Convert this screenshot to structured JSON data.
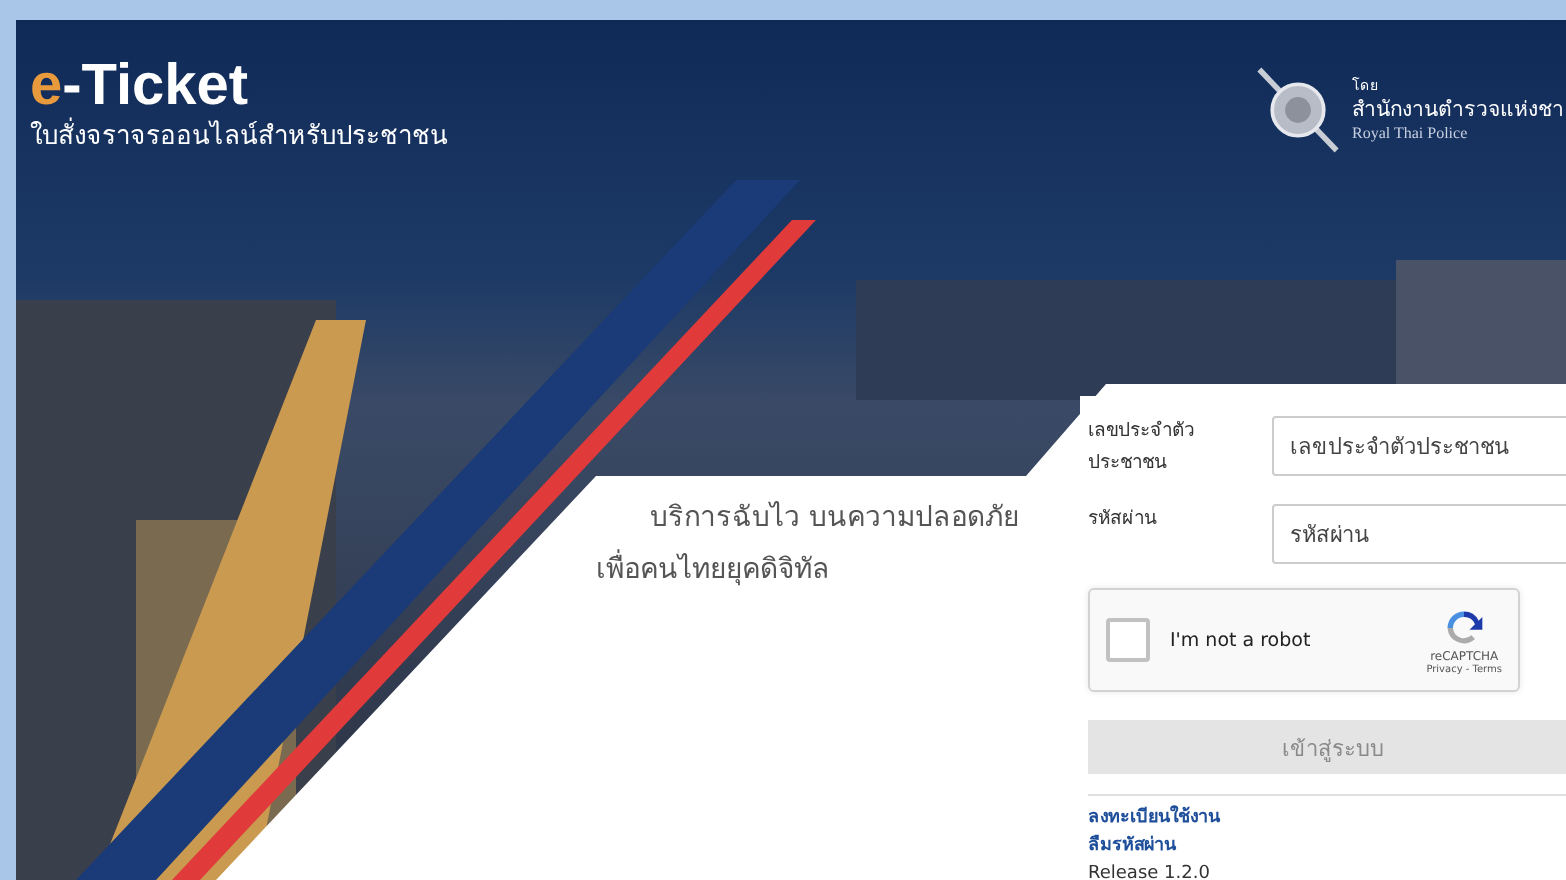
{
  "brand": {
    "title": "e-Ticket",
    "subtitle": "ใบสั่งจราจรออนไลน์สำหรับประชาชน"
  },
  "agency": {
    "prefix": "โดย",
    "name": "สำนักงานตำรวจแห่งชา",
    "name_en": "Royal Thai Police"
  },
  "tagline": [
    "บริการฉับไว บนความปลอดภัย",
    "เพื่อคนไทยยุคดิจิทัล"
  ],
  "login": {
    "fields": [
      {
        "label": "เลขประจำตัวประชาชน",
        "placeholder": "เลขประจำตัวประชาชน"
      },
      {
        "label": "รหัสผ่าน",
        "placeholder": "รหัสผ่าน"
      }
    ],
    "captcha": {
      "label": "I'm not a robot",
      "checked": false,
      "brand": "reCAPTCHA",
      "links": "Privacy - Terms"
    },
    "submit": {
      "label": "เข้าสู่ระบบ",
      "disabled": true
    },
    "links": [
      "ลงทะเบียนใช้งาน",
      "ลืมรหัสผ่าน"
    ],
    "release": "Release 1.2.0"
  }
}
